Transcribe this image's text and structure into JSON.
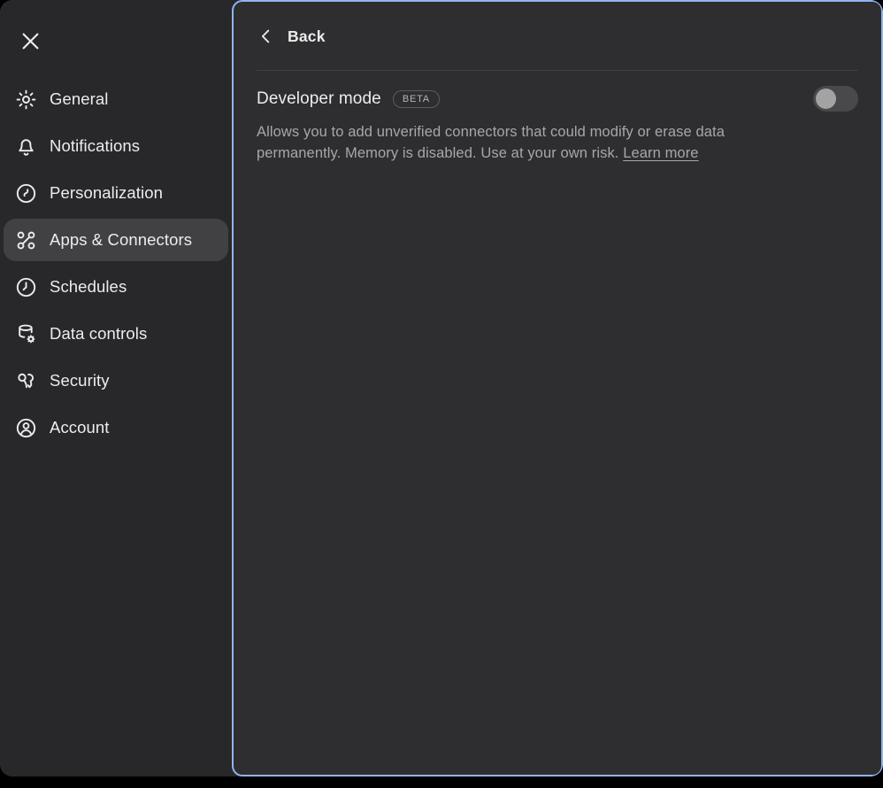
{
  "colors": {
    "page_bg": "#000000",
    "sidebar_bg": "#28282a",
    "panel_bg": "#2e2e30",
    "focus_ring": "#8fb5f1",
    "selected_item_bg": "#414143",
    "text_primary": "#ececec",
    "text_secondary": "#a7a7a7"
  },
  "sidebar": {
    "close_icon": "x-icon",
    "items": [
      {
        "label": "General",
        "icon": "gear",
        "selected": false
      },
      {
        "label": "Notifications",
        "icon": "bell",
        "selected": false
      },
      {
        "label": "Personalization",
        "icon": "personalization",
        "selected": false
      },
      {
        "label": "Apps & Connectors",
        "icon": "apps-connectors",
        "selected": true
      },
      {
        "label": "Schedules",
        "icon": "clock",
        "selected": false
      },
      {
        "label": "Data controls",
        "icon": "database-gear",
        "selected": false
      },
      {
        "label": "Security",
        "icon": "keys",
        "selected": false
      },
      {
        "label": "Account",
        "icon": "person-circle",
        "selected": false
      }
    ]
  },
  "panel": {
    "back_label": "Back",
    "setting": {
      "title": "Developer mode",
      "badge": "BETA",
      "toggle_state": "off",
      "description": "Allows you to add unverified connectors that could modify or erase data permanently. Memory is disabled. Use at your own risk. ",
      "link_label": "Learn more"
    }
  }
}
